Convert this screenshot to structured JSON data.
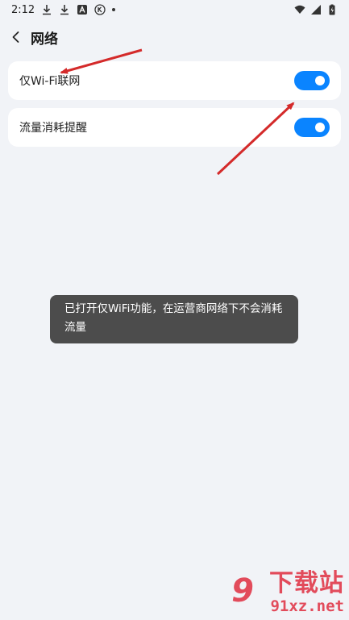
{
  "status_bar": {
    "time": "2:12",
    "left_icons": [
      "download-icon",
      "download-icon",
      "app-store-icon",
      "k-app-icon",
      "dot-icon"
    ],
    "right_icons": [
      "wifi-icon",
      "signal-icon",
      "battery-charging-icon"
    ]
  },
  "header": {
    "title": "网络",
    "back_icon": "chevron-left-icon"
  },
  "settings": [
    {
      "label": "仅Wi-Fi联网",
      "enabled": true
    },
    {
      "label": "流量消耗提醒",
      "enabled": true
    }
  ],
  "toast": {
    "text": "已打开仅WiFi功能，在运营商网络下不会消耗流量"
  },
  "watermark": {
    "logo": "9",
    "name": "下载站",
    "url": "91xz.net"
  },
  "colors": {
    "background": "#f1f3f7",
    "toggle_on": "#0a84ff",
    "toast_bg": "#4c4c4c",
    "annotation_arrow": "#d42a2a",
    "watermark": "#e24b5b"
  }
}
